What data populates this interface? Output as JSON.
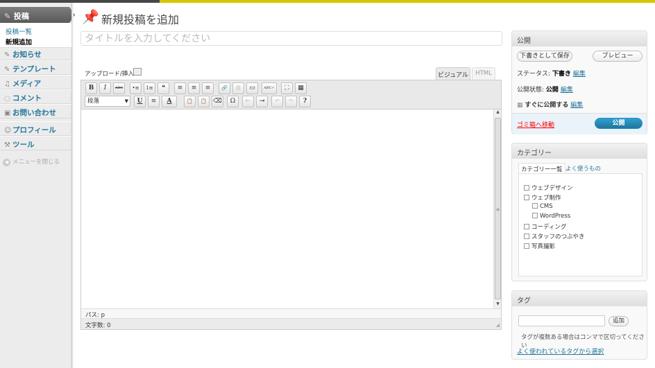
{
  "sidebar": {
    "active": {
      "label": "投稿",
      "icon": "pin-icon"
    },
    "submenu": [
      {
        "label": "投稿一覧"
      },
      {
        "label": "新規追加"
      }
    ],
    "items": [
      {
        "label": "お知らせ",
        "icon": "pin-icon"
      },
      {
        "label": "テンプレート",
        "icon": "pin-icon"
      },
      {
        "label": "メディア",
        "icon": "media-icon"
      },
      {
        "label": "コメント",
        "icon": "comment-icon"
      },
      {
        "label": "お問い合わせ",
        "icon": "contact-icon"
      },
      {
        "label": "プロフィール",
        "icon": "users-icon"
      },
      {
        "label": "ツール",
        "icon": "tools-icon"
      }
    ],
    "collapse_label": "メニューを閉じる"
  },
  "header": {
    "title": "新規投稿を追加",
    "icon": "pushpin-icon"
  },
  "title_input": {
    "placeholder": "タイトルを入力してください",
    "value": ""
  },
  "upload": {
    "label": "アップロード/挿入"
  },
  "editor_tabs": {
    "visual": "ビジュアル",
    "html": "HTML"
  },
  "toolbar": {
    "row1": [
      "B",
      "I",
      "ABC",
      "•≡",
      "1≡",
      "❝",
      "≡",
      "≡",
      "≡",
      "🔗",
      "⛓",
      "▭",
      "ABC✓",
      "⛶",
      "▦"
    ],
    "format_select": "段落",
    "row2": [
      "U",
      "≡",
      "A",
      "📋",
      "📋",
      "⌫",
      "Ω",
      "⇤",
      "⇥",
      "↶",
      "↷",
      "?"
    ]
  },
  "editor_status": {
    "path": "パス: p",
    "word_count": "文字数: 0"
  },
  "publish": {
    "title": "公開",
    "save_draft": "下書きとして保存",
    "preview": "プレビュー",
    "status_label": "ステータス:",
    "status_value": "下書き",
    "visibility_label": "公開状態:",
    "visibility_value": "公開",
    "schedule_text": "すぐに公開する",
    "edit_link": "編集",
    "trash": "ゴミ箱へ移動",
    "publish_button": "公開"
  },
  "category": {
    "title": "カテゴリー",
    "tab_all": "カテゴリー一覧",
    "tab_popular": "よく使うもの",
    "items": [
      {
        "label": "ウェブデザイン",
        "checked": false
      },
      {
        "label": "ウェブ制作",
        "checked": false
      },
      {
        "label": "CMS",
        "checked": false
      },
      {
        "label": "WordPress",
        "checked": false
      },
      {
        "label": "コーディング",
        "checked": false
      },
      {
        "label": "スタッフのつぶやき",
        "checked": false
      },
      {
        "label": "写真撮影",
        "checked": false
      }
    ]
  },
  "tags": {
    "title": "タグ",
    "add_button": "追加",
    "hint": "タグが複数ある場合はコンマで区切ってください",
    "popular_link": "よく使われているタグから選択"
  }
}
